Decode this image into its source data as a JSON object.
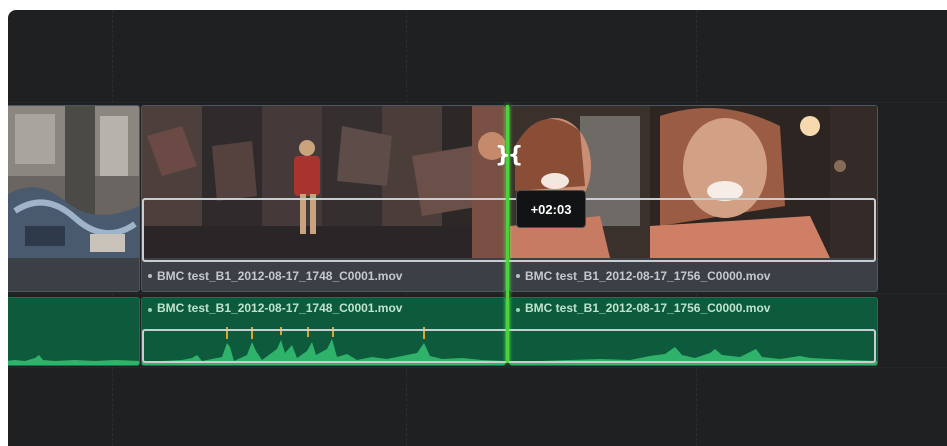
{
  "timeline": {
    "video_track": {
      "clips": [
        {
          "name": "",
          "kind": "graffiti-wall"
        },
        {
          "name": "BMC test_B1_2012-08-17_1748_C0001.mov",
          "kind": "graffiti-dancer"
        },
        {
          "name": "BMC test_B1_2012-08-17_1756_C0000.mov",
          "kind": "woman-laughing"
        }
      ]
    },
    "audio_track": {
      "clips": [
        {
          "name": ""
        },
        {
          "name": "BMC test_B1_2012-08-17_1748_C0001.mov"
        },
        {
          "name": "BMC test_B1_2012-08-17_1756_C0000.mov"
        }
      ]
    },
    "trim_tooltip": "+02:03",
    "colors": {
      "background": "#1f2022",
      "playhead": "#4cd23d",
      "audio_clip": "#0d5b3c",
      "video_clip": "#3b4147",
      "audio_peak": "#e0a526"
    }
  }
}
